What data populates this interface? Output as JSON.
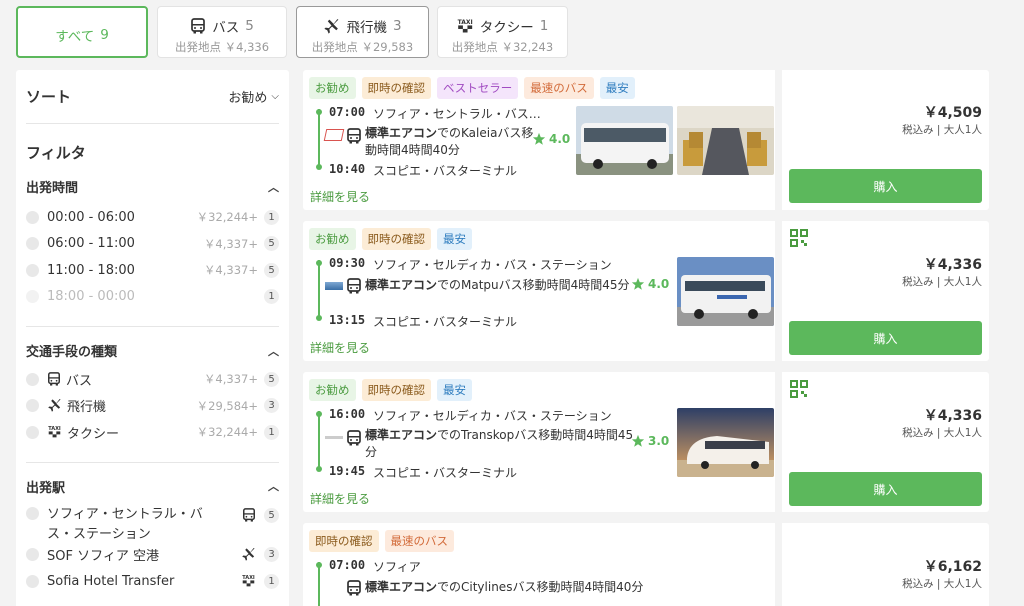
{
  "tabs": [
    {
      "label": "すべて",
      "count": "9",
      "sub": ""
    },
    {
      "label": "バス",
      "count": "5",
      "sub": "出発地点 ￥4,336"
    },
    {
      "label": "飛行機",
      "count": "3",
      "sub": "出発地点 ￥29,583"
    },
    {
      "label": "タクシー",
      "count": "1",
      "sub": "出発地点 ￥32,243"
    }
  ],
  "sidebar": {
    "sort_title": "ソート",
    "sort_value": "お勧め",
    "filter_title": "フィルタ",
    "departure_time": {
      "title": "出発時間",
      "items": [
        {
          "label": "00:00 - 06:00",
          "price": "￥32,244+",
          "count": "1"
        },
        {
          "label": "06:00 - 11:00",
          "price": "￥4,337+",
          "count": "5"
        },
        {
          "label": "11:00 - 18:00",
          "price": "￥4,337+",
          "count": "5"
        },
        {
          "label": "18:00 - 00:00",
          "price": "",
          "count": "1"
        }
      ]
    },
    "transport": {
      "title": "交通手段の種類",
      "items": [
        {
          "label": "バス",
          "price": "￥4,337+",
          "count": "5"
        },
        {
          "label": "飛行機",
          "price": "￥29,584+",
          "count": "3"
        },
        {
          "label": "タクシー",
          "price": "￥32,244+",
          "count": "1"
        }
      ]
    },
    "station": {
      "title": "出発駅",
      "items": [
        {
          "label1": "ソフィア・セントラル・バ",
          "label2": "ス・ステーション",
          "count": "5"
        },
        {
          "label": "SOF ソフィア 空港",
          "count": "3"
        },
        {
          "label": "Sofia Hotel Transfer",
          "count": "1"
        }
      ]
    }
  },
  "taxi_icon_text": "TAXI",
  "results": [
    {
      "tags": [
        "お勧め",
        "即時の確認",
        "ベストセラー",
        "最速のバス",
        "最安"
      ],
      "dep_time": "07:00",
      "dep_station": "ソフィア・セントラル・バス…",
      "desc_bold": "標準エアコン",
      "desc1": "でのKaleiaバス移",
      "desc2": "動時間4時間40分",
      "rating": "4.0",
      "arr_time": "10:40",
      "arr_station": "スコピエ・バスターミナル",
      "details": "詳細を見る",
      "price": "￥4,509",
      "price_sub": "税込み | 大人1人",
      "buy": "購入"
    },
    {
      "tags": [
        "お勧め",
        "即時の確認",
        "最安"
      ],
      "dep_time": "09:30",
      "dep_station": "ソフィア・セルディカ・バス・ステーション",
      "desc_bold": "標準エアコン",
      "desc1": "でのMatpuバス移動時間4時間45分",
      "desc2": "",
      "rating": "4.0",
      "arr_time": "13:15",
      "arr_station": "スコピエ・バスターミナル",
      "details": "詳細を見る",
      "price": "￥4,336",
      "price_sub": "税込み | 大人1人",
      "buy": "購入"
    },
    {
      "tags": [
        "お勧め",
        "即時の確認",
        "最安"
      ],
      "dep_time": "16:00",
      "dep_station": "ソフィア・セルディカ・バス・ステーション",
      "desc_bold": "標準エアコン",
      "desc1": "でのTranskopバス移動時間4時間45",
      "desc2": "分",
      "rating": "3.0",
      "arr_time": "19:45",
      "arr_station": "スコピエ・バスターミナル",
      "details": "詳細を見る",
      "price": "￥4,336",
      "price_sub": "税込み | 大人1人",
      "buy": "購入"
    },
    {
      "tags": [
        "即時の確認",
        "最速のバス"
      ],
      "dep_time": "07:00",
      "dep_station": "ソフィア",
      "desc_bold": "標準エアコン",
      "desc1": "でのCitylinesバス移動時間4時間40分",
      "desc2": "",
      "price": "￥6,162",
      "price_sub": "税込み | 大人1人"
    }
  ],
  "colors": {
    "accent": "#5cb85c"
  }
}
